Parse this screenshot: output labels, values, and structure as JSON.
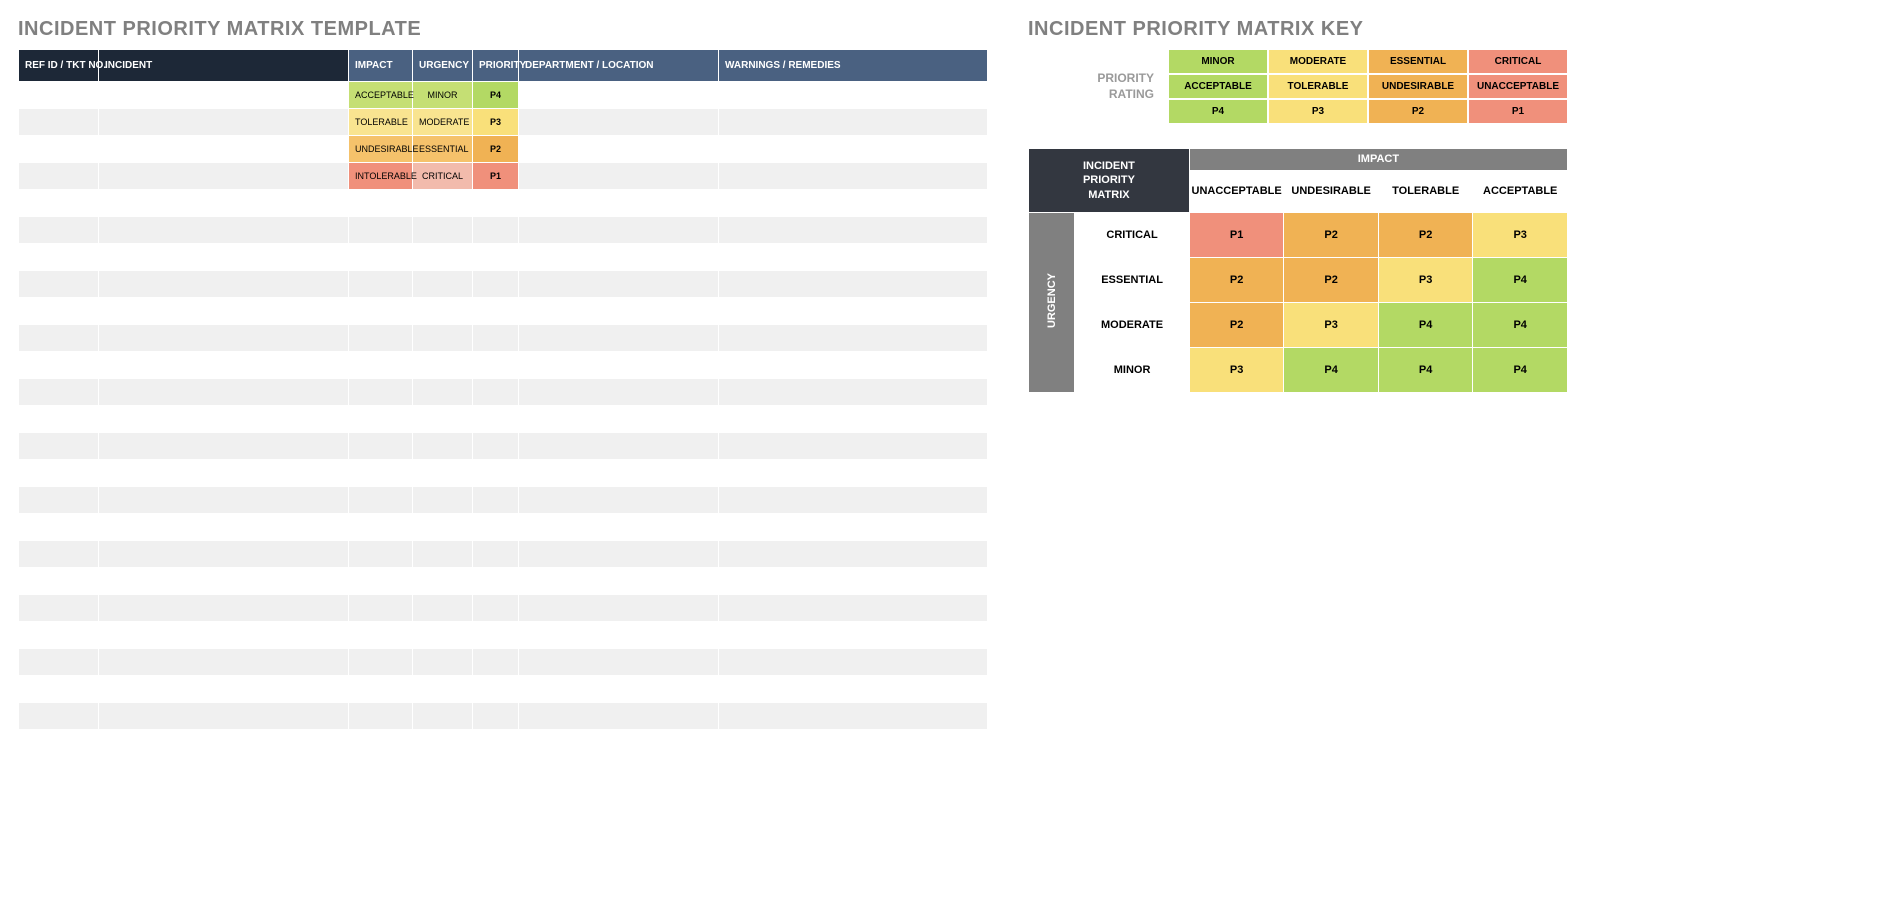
{
  "left": {
    "title": "INCIDENT PRIORITY MATRIX TEMPLATE",
    "headers": {
      "ref": "REF ID / TKT NO.",
      "incident": "INCIDENT",
      "impact": "IMPACT",
      "urgency": "URGENCY",
      "priority": "PRIORITY",
      "department": "DEPARTMENT / LOCATION",
      "warnings": "WARNINGS / REMEDIES"
    },
    "rows": [
      {
        "impact": "ACCEPTABLE",
        "impact_cls": "c-green1",
        "urgency": "MINOR",
        "urgency_cls": "c-green1",
        "priority": "P4",
        "priority_cls": "c-green2"
      },
      {
        "impact": "TOLERABLE",
        "impact_cls": "c-yellow1",
        "urgency": "MODERATE",
        "urgency_cls": "c-yellow1",
        "priority": "P3",
        "priority_cls": "c-yellow2"
      },
      {
        "impact": "UNDESIRABLE",
        "impact_cls": "c-orange1",
        "urgency": "ESSENTIAL",
        "urgency_cls": "c-orange1",
        "priority": "P2",
        "priority_cls": "c-orange2"
      },
      {
        "impact": "INTOLERABLE",
        "impact_cls": "c-red2",
        "urgency": "CRITICAL",
        "urgency_cls": "c-red1",
        "priority": "P1",
        "priority_cls": "c-red2"
      }
    ],
    "empty_rows": 21,
    "total_rows": 25
  },
  "right": {
    "title": "INCIDENT PRIORITY MATRIX KEY",
    "rating": {
      "label": "PRIORITY\nRATING",
      "cols": [
        {
          "top": "MINOR",
          "mid": "ACCEPTABLE",
          "p": "P4",
          "cls": "c-green2"
        },
        {
          "top": "MODERATE",
          "mid": "TOLERABLE",
          "p": "P3",
          "cls": "c-yellow2"
        },
        {
          "top": "ESSENTIAL",
          "mid": "UNDESIRABLE",
          "p": "P2",
          "cls": "c-orange2"
        },
        {
          "top": "CRITICAL",
          "mid": "UNACCEPTABLE",
          "p": "P1",
          "cls": "c-red2"
        }
      ]
    },
    "matrix": {
      "corner": "INCIDENT\nPRIORITY\nMATRIX",
      "impact_label": "IMPACT",
      "urgency_label": "URGENCY",
      "impact_cols": [
        "UNACCEPTABLE",
        "UNDESIRABLE",
        "TOLERABLE",
        "ACCEPTABLE"
      ],
      "urgency_rows": [
        "CRITICAL",
        "ESSENTIAL",
        "MODERATE",
        "MINOR"
      ],
      "cells": [
        [
          {
            "v": "P1",
            "c": "c-red2"
          },
          {
            "v": "P2",
            "c": "c-orange2"
          },
          {
            "v": "P2",
            "c": "c-orange2"
          },
          {
            "v": "P3",
            "c": "c-yellow2"
          }
        ],
        [
          {
            "v": "P2",
            "c": "c-orange2"
          },
          {
            "v": "P2",
            "c": "c-orange2"
          },
          {
            "v": "P3",
            "c": "c-yellow2"
          },
          {
            "v": "P4",
            "c": "c-green2"
          }
        ],
        [
          {
            "v": "P2",
            "c": "c-orange2"
          },
          {
            "v": "P3",
            "c": "c-yellow2"
          },
          {
            "v": "P4",
            "c": "c-green2"
          },
          {
            "v": "P4",
            "c": "c-green2"
          }
        ],
        [
          {
            "v": "P3",
            "c": "c-yellow2"
          },
          {
            "v": "P4",
            "c": "c-green2"
          },
          {
            "v": "P4",
            "c": "c-green2"
          },
          {
            "v": "P4",
            "c": "c-green2"
          }
        ]
      ]
    }
  },
  "colors": {
    "header_dark": "#1d2837",
    "header_blue": "#4a6181",
    "header_gray": "#808080",
    "green": "#b3d964",
    "yellow": "#f9e07a",
    "orange": "#f0b254",
    "red": "#f0907b"
  }
}
